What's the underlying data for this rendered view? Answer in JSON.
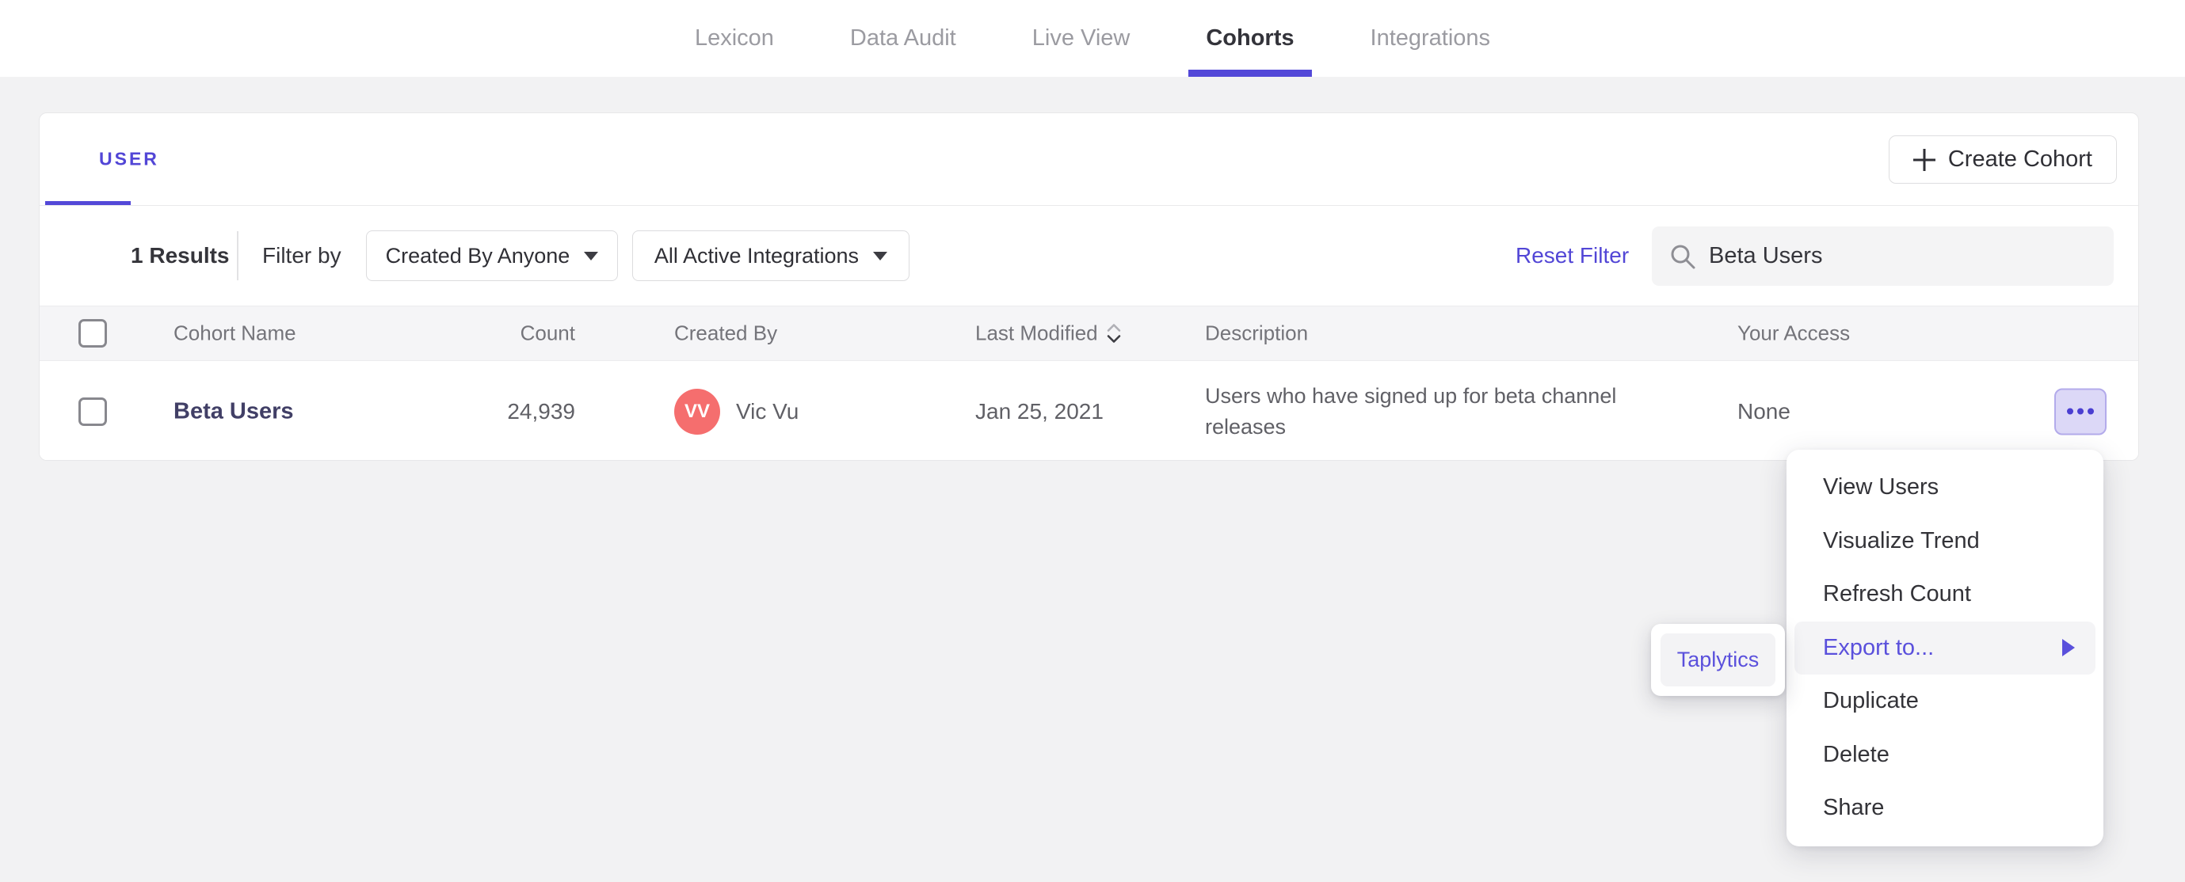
{
  "colors": {
    "accent": "#5246d6",
    "active_tab_underline": "#5348d8",
    "avatar": "#f56e6e",
    "actions_button_bg": "#dcd8f7",
    "page_bg": "#f2f2f3"
  },
  "top_nav": {
    "items": [
      {
        "label": "Lexicon",
        "active": false
      },
      {
        "label": "Data Audit",
        "active": false
      },
      {
        "label": "Live View",
        "active": false
      },
      {
        "label": "Cohorts",
        "active": true
      },
      {
        "label": "Integrations",
        "active": false
      }
    ]
  },
  "panel": {
    "tab_label": "USER",
    "create_button": {
      "label": "Create Cohort"
    },
    "filter_bar": {
      "results_count": "1 Results",
      "filter_by_label": "Filter by",
      "dropdowns": [
        {
          "label": "Created By Anyone"
        },
        {
          "label": "All Active Integrations"
        }
      ],
      "reset_label": "Reset Filter",
      "search": {
        "value": "Beta Users"
      }
    },
    "table": {
      "columns": [
        "Cohort Name",
        "Count",
        "Created By",
        "Last Modified",
        "Description",
        "Your Access"
      ],
      "rows": [
        {
          "name": "Beta Users",
          "count": "24,939",
          "created_by": {
            "initials": "VV",
            "name": "Vic Vu"
          },
          "last_modified": "Jan 25, 2021",
          "description": "Users who have signed up for beta channel releases",
          "your_access": "None"
        }
      ]
    }
  },
  "context_menu": {
    "items": [
      {
        "label": "View Users"
      },
      {
        "label": "Visualize Trend"
      },
      {
        "label": "Refresh Count"
      },
      {
        "label": "Export to..."
      },
      {
        "label": "Duplicate"
      },
      {
        "label": "Delete"
      },
      {
        "label": "Share"
      }
    ],
    "highlighted_label": "Export to...",
    "submenu": {
      "items": [
        {
          "label": "Taplytics"
        }
      ]
    }
  }
}
